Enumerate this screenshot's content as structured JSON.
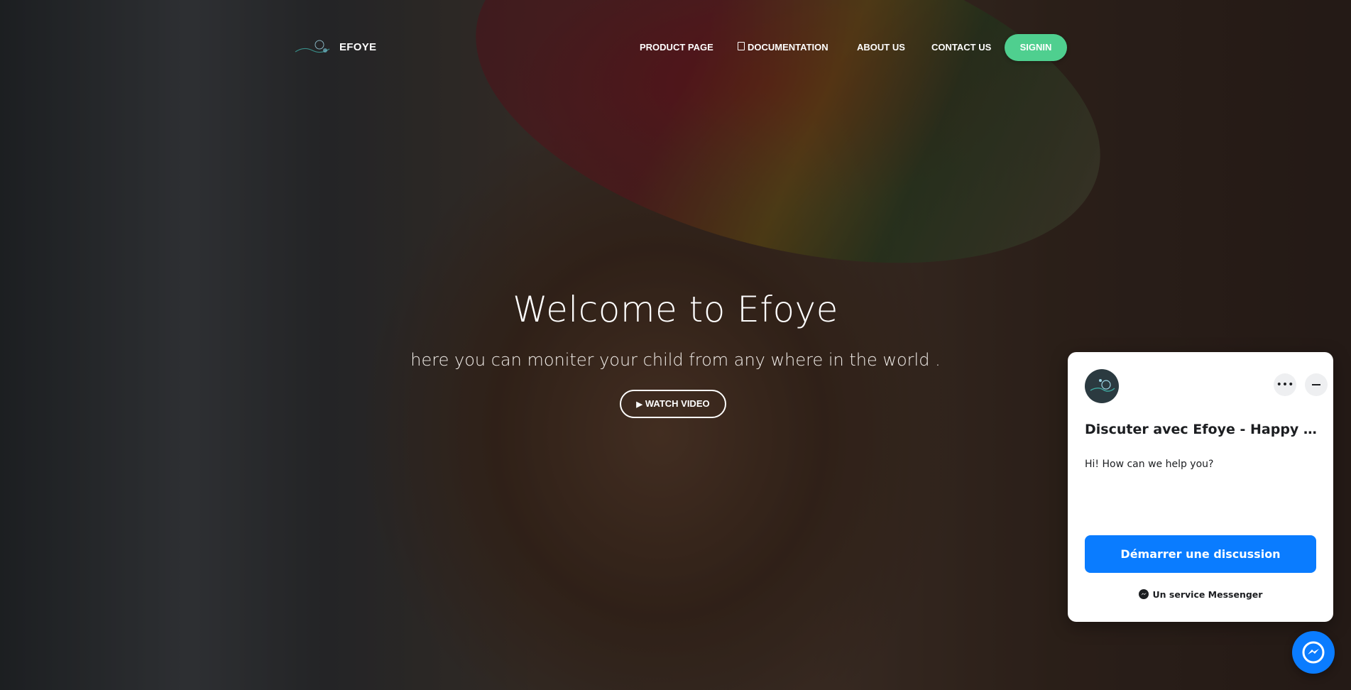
{
  "brand": {
    "name": "EFOYE",
    "logo_icon": "efoye-logo-icon"
  },
  "nav": {
    "items": [
      {
        "label": "PRODUCT PAGE"
      },
      {
        "label": "DOCUMENTATION",
        "icon": "document-icon"
      },
      {
        "label": "ABOUT US"
      },
      {
        "label": "CONTACT US"
      }
    ],
    "signin_label": "SIGNIN"
  },
  "hero": {
    "title": "Welcome to Efoye",
    "subtitle": "here you can moniter your child from any where in the world .",
    "watch_label": "WATCH VIDEO",
    "watch_icon": "play-icon"
  },
  "chat_widget": {
    "title": "Discuter avec Efoye - Happy baby",
    "message": "Hi! How can we help you?",
    "start_label": "Démarrer une discussion",
    "footer": "Un service Messenger",
    "more_icon": "more-options-icon",
    "minimize_icon": "minimize-icon"
  },
  "colors": {
    "signin_bg": "#4fcf8f",
    "messenger_blue": "#0a7cff",
    "overlay": "rgba(0,0,0,0.38)"
  }
}
